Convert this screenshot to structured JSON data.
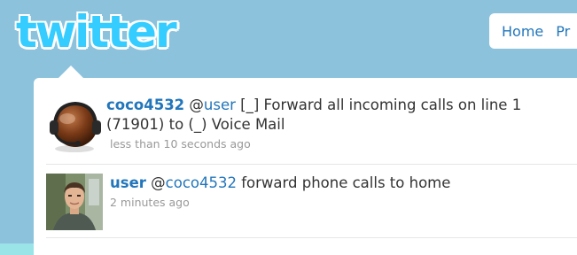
{
  "header": {
    "logo_text": "twitter",
    "nav": [
      {
        "label": "Home"
      },
      {
        "label": "Pr"
      }
    ]
  },
  "tweets": [
    {
      "screen_name": "coco4532",
      "at": "@",
      "mention": "user",
      "text_line1": " [_] Forward all incoming calls on line 1",
      "text_line2": "(71901) to (_) Voice Mail",
      "timestamp": "less than 10 seconds ago",
      "avatar_icon": "headset-avatar-icon"
    },
    {
      "screen_name": "user",
      "at": " @",
      "mention": "coco4532",
      "text_line1": " forward phone calls to home",
      "text_line2": "",
      "timestamp": "2 minutes ago",
      "avatar_icon": "user-photo-avatar"
    }
  ],
  "colors": {
    "background": "#8cc2dc",
    "link": "#2276bb",
    "logo": "#35ccff",
    "meta": "#999999"
  }
}
